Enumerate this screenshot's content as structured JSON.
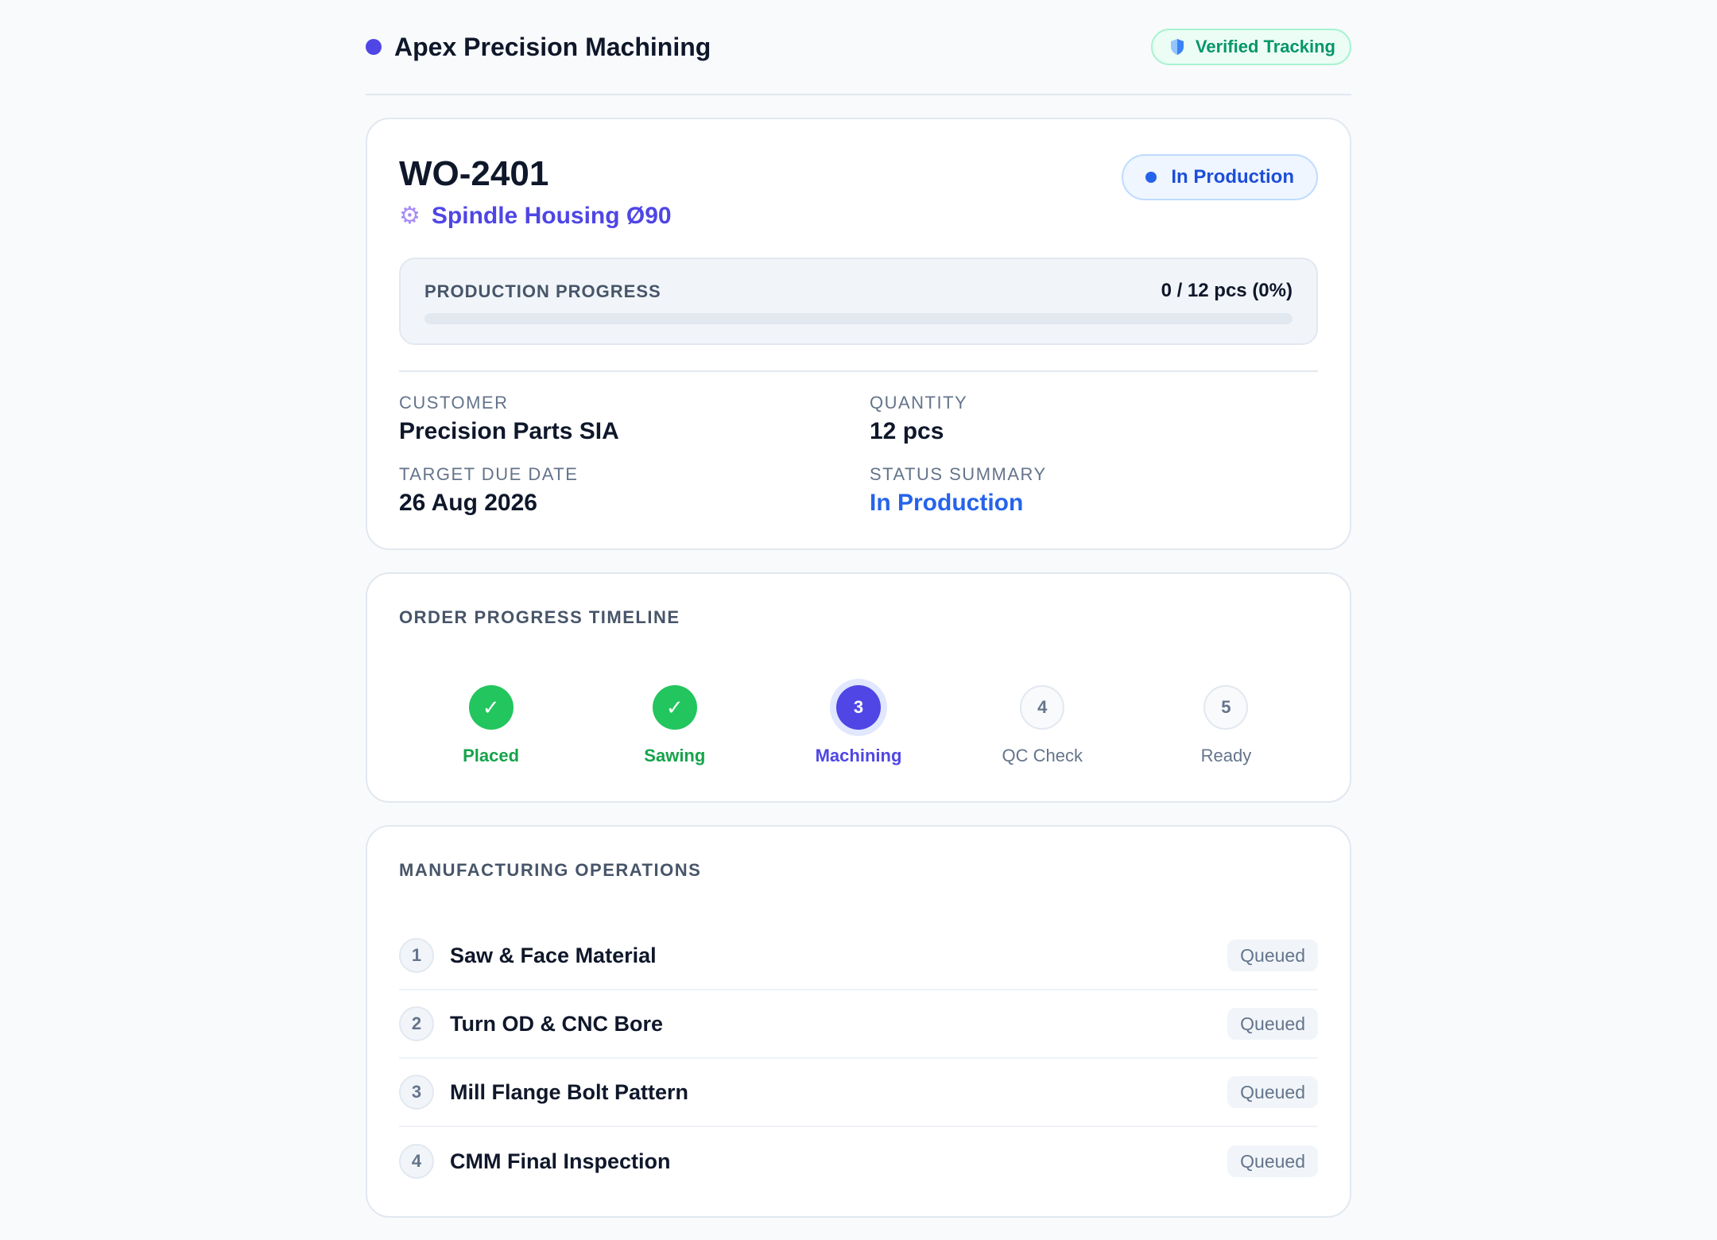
{
  "header": {
    "brand_name": "Apex Precision Machining",
    "verified_label": "Verified Tracking"
  },
  "order": {
    "id": "WO-2401",
    "part_name": "Spindle Housing Ø90",
    "part_icon": "gear-icon",
    "status": "In Production",
    "progress": {
      "label": "PRODUCTION PROGRESS",
      "value_text": "0 / 12 pcs (0%)",
      "fraction": 0
    },
    "fields": {
      "customer_label": "CUSTOMER",
      "customer_value": "Precision Parts SIA",
      "quantity_label": "QUANTITY",
      "quantity_value": "12 pcs",
      "due_label": "TARGET DUE DATE",
      "due_value": "26 Aug 2026",
      "status_label": "STATUS SUMMARY",
      "status_value": "In Production"
    }
  },
  "timeline": {
    "title": "ORDER PROGRESS TIMELINE",
    "steps": [
      {
        "marker": "✓",
        "label": "Placed",
        "state": "done"
      },
      {
        "marker": "✓",
        "label": "Sawing",
        "state": "done"
      },
      {
        "marker": "3",
        "label": "Machining",
        "state": "current"
      },
      {
        "marker": "4",
        "label": "QC Check",
        "state": "todo"
      },
      {
        "marker": "5",
        "label": "Ready",
        "state": "todo"
      }
    ]
  },
  "operations": {
    "title": "MANUFACTURING OPERATIONS",
    "items": [
      {
        "num": "1",
        "name": "Saw & Face Material",
        "status": "Queued"
      },
      {
        "num": "2",
        "name": "Turn OD & CNC Bore",
        "status": "Queued"
      },
      {
        "num": "3",
        "name": "Mill Flange Bolt Pattern",
        "status": "Queued"
      },
      {
        "num": "4",
        "name": "CMM Final Inspection",
        "status": "Queued"
      }
    ]
  },
  "colors": {
    "accent": "#4f46e5",
    "success": "#22c55e",
    "info": "#2563eb",
    "verified": "#059669"
  }
}
